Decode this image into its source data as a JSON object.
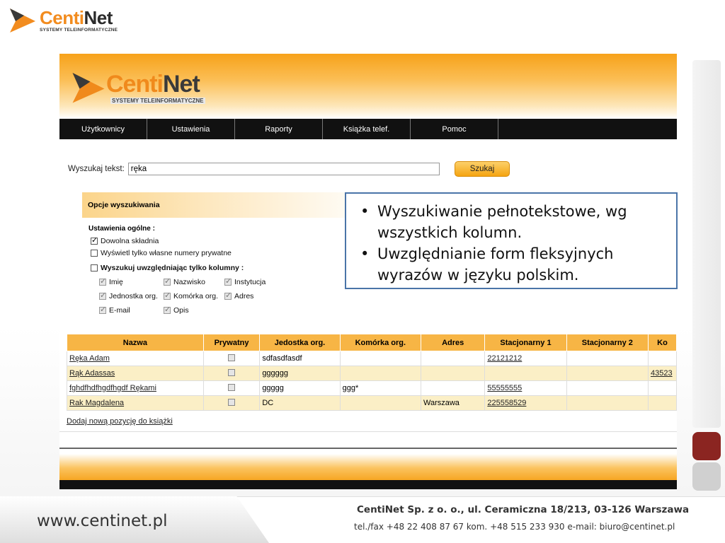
{
  "slide": {
    "logo": {
      "brand_part1": "Centi",
      "brand_part2": "Net",
      "tagline": "SYSTEMY TELEINFORMATYCZNE"
    },
    "callout": {
      "items": [
        "Wyszukiwanie pełnotekstowe, wg wszystkich kolumn.",
        "Uwzględnianie form fleksyjnych wyrazów w języku polskim."
      ]
    },
    "footer": {
      "website": "www.centinet.pl",
      "company": "CentiNet Sp. z o. o., ul. Ceramiczna 18/213, 03-126 Warszawa",
      "contacts": "tel./fax +48 22 408 87 67 kom. +48 515 233 930 e-mail: biuro@centinet.pl"
    },
    "colors": {
      "accent": "#f7a21a",
      "callout_border": "#4a74a8",
      "side_red": "#8b2521"
    }
  },
  "app": {
    "logo": {
      "brand_part1": "Centi",
      "brand_part2": "Net",
      "tagline": "SYSTEMY TELEINFORMATYCZNE"
    },
    "menu": [
      "Użytkownicy",
      "Ustawienia",
      "Raporty",
      "Książka telef.",
      "Pomoc"
    ],
    "search": {
      "label": "Wyszukaj tekst:",
      "value": "ręka",
      "button": "Szukaj"
    },
    "options": {
      "title": "Opcje wyszukiwania",
      "general_label": "Ustawienia ogólne :",
      "dowolna": {
        "label": "Dowolna składnia",
        "checked": true
      },
      "private": {
        "label": "Wyświetl tylko własne numery prywatne",
        "checked": false
      },
      "columns_only": {
        "label": "Wyszukuj uwzględniając tylko kolumny :",
        "checked": false
      },
      "columns": [
        {
          "label": "Imię",
          "checked": true
        },
        {
          "label": "Nazwisko",
          "checked": true
        },
        {
          "label": "Instytucja",
          "checked": true
        },
        {
          "label": "Jednostka org.",
          "checked": true
        },
        {
          "label": "Komórka org.",
          "checked": true
        },
        {
          "label": "Adres",
          "checked": true
        },
        {
          "label": "E-mail",
          "checked": true
        },
        {
          "label": "Opis",
          "checked": true
        }
      ]
    },
    "table": {
      "headers": [
        "Nazwa",
        "Prywatny",
        "Jedostka org.",
        "Komórka org.",
        "Adres",
        "Stacjonarny 1",
        "Stacjonarny 2",
        "Ko"
      ],
      "rows": [
        {
          "name": "Ręka Adam",
          "private": false,
          "unit": "sdfasdfasdf",
          "cell": "",
          "address": "",
          "phone1": "22121212",
          "phone2": "",
          "extra": ""
        },
        {
          "name": "Rąk Adassas",
          "private": false,
          "unit": "gggggg",
          "cell": "",
          "address": "",
          "phone1": "",
          "phone2": "",
          "extra": "43523"
        },
        {
          "name": "fghdfhdfhgdfhgdf Rękami",
          "private": false,
          "unit": "ggggg",
          "cell": "ggg*",
          "address": "",
          "phone1": "55555555",
          "phone2": "",
          "extra": ""
        },
        {
          "name": "Rak Magdalena",
          "private": false,
          "unit": "DC",
          "cell": "",
          "address": "Warszawa",
          "phone1": "225558529",
          "phone2": "",
          "extra": ""
        }
      ]
    },
    "add_link": "Dodaj nową pozycję do książki"
  }
}
